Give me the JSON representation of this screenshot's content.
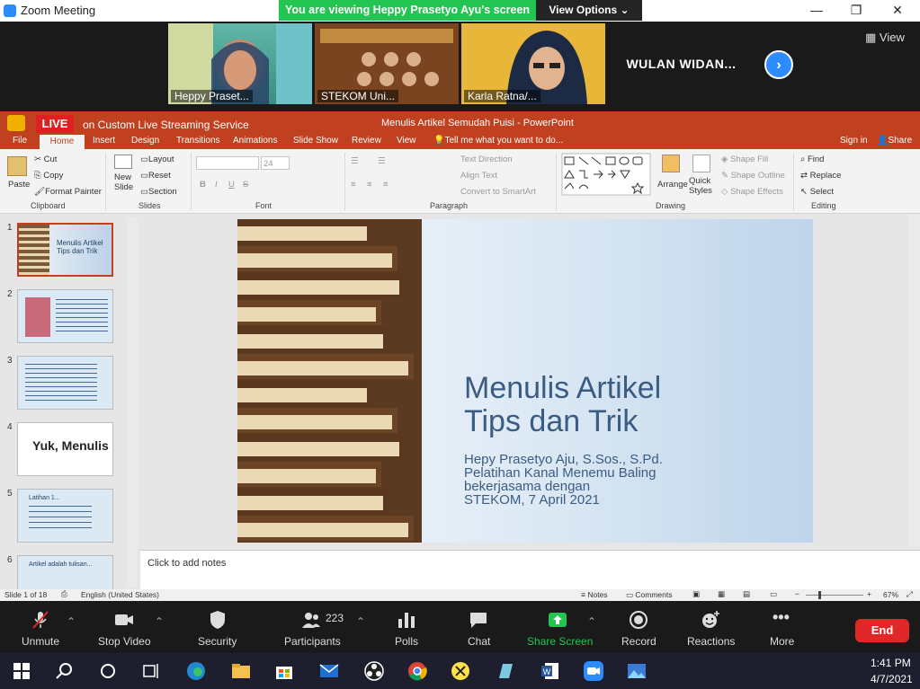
{
  "window": {
    "title": "Zoom Meeting",
    "share_banner": "You are viewing Heppy Prasetyo Ayu's screen",
    "view_options": "View Options"
  },
  "gallery": {
    "participants": [
      {
        "name": "Heppy Praset..."
      },
      {
        "name": "STEKOM Uni..."
      },
      {
        "name": "Karla Ratna/..."
      },
      {
        "name": "WULAN WIDAN..."
      }
    ],
    "view_label": "View"
  },
  "ppt": {
    "live_badge": "LIVE",
    "live_service": "on Custom Live Streaming Service",
    "doc_title": "Menulis Artikel Semudah Puisi - PowerPoint",
    "tabs": [
      "File",
      "Home",
      "Insert",
      "Design",
      "Transitions",
      "Animations",
      "Slide Show",
      "Review",
      "View"
    ],
    "tell_me": "Tell me what you want to do...",
    "sign_in": "Sign in",
    "share": "Share",
    "ribbon": {
      "paste": "Paste",
      "cut": "Cut",
      "copy": "Copy",
      "format_painter": "Format Painter",
      "new_slide": "New Slide",
      "layout": "Layout",
      "reset": "Reset",
      "section": "Section",
      "font_size": "24",
      "text_direction": "Text Direction",
      "align_text": "Align Text",
      "convert_smartart": "Convert to SmartArt",
      "arrange": "Arrange",
      "quick_styles": "Quick Styles",
      "shape_fill": "Shape Fill",
      "shape_outline": "Shape Outline",
      "shape_effects": "Shape Effects",
      "find": "Find",
      "replace": "Replace",
      "select": "Select",
      "groups": [
        "Clipboard",
        "Slides",
        "Font",
        "Paragraph",
        "Drawing",
        "Editing"
      ]
    },
    "thumbs": [
      {
        "num": "1",
        "title": "Menulis Artikel Tips dan Trik"
      },
      {
        "num": "2",
        "title": ""
      },
      {
        "num": "3",
        "title": ""
      },
      {
        "num": "4",
        "title": "Yuk, Menulis"
      },
      {
        "num": "5",
        "title": "Latihan 1..."
      },
      {
        "num": "6",
        "title": "Artikel adalah tulisan..."
      }
    ],
    "slide": {
      "title_line1": "Menulis Artikel",
      "title_line2": "Tips dan Trik",
      "sub1": "Hepy Prasetyo Aju, S.Sos., S.Pd.",
      "sub2": "Pelatihan Kanal Menemu Baling",
      "sub3": "bekerjasama dengan",
      "sub4": "STEKOM, 7 April 2021"
    },
    "notes_hint": "Click to add notes",
    "status": {
      "slide_of": "Slide 1 of 18",
      "language": "English (United States)",
      "notes": "Notes",
      "comments": "Comments",
      "zoom": "67%"
    }
  },
  "controls": {
    "unmute": "Unmute",
    "stop_video": "Stop Video",
    "security": "Security",
    "participants": "Participants",
    "participants_count": "223",
    "polls": "Polls",
    "chat": "Chat",
    "share_screen": "Share Screen",
    "record": "Record",
    "reactions": "Reactions",
    "more": "More",
    "end": "End"
  },
  "taskbar": {
    "time": "1:41 PM",
    "date": "4/7/2021"
  },
  "colors": {
    "accent": "#c1401f",
    "zoom_blue": "#2d8cff",
    "share_green": "#23c552",
    "end_red": "#e02828"
  }
}
